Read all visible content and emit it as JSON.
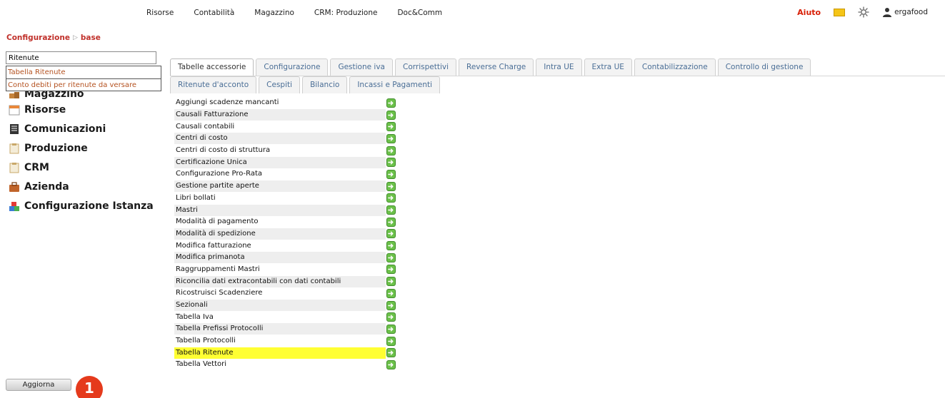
{
  "topnav": {
    "menu": [
      "Risorse",
      "Contabilità",
      "Magazzino",
      "CRM: Produzione",
      "Doc&Comm"
    ],
    "help": "Aiuto",
    "user": "ergafood"
  },
  "breadcrumb": {
    "first": "Configurazione",
    "sep": "▷",
    "second": "base"
  },
  "search": {
    "value": "Ritenute",
    "suggestions": [
      "Tabella Ritenute",
      "Conto debiti per ritenute da versare"
    ]
  },
  "sidebar": {
    "items": [
      {
        "label": "Magazzino",
        "icon": "boxes-icon",
        "color": "#c6833b"
      },
      {
        "label": "Risorse",
        "icon": "calendar-icon",
        "color": "#e8873a"
      },
      {
        "label": "Comunicazioni",
        "icon": "document-icon",
        "color": "#333333"
      },
      {
        "label": "Produzione",
        "icon": "clipboard-icon",
        "color": "#c9a86a"
      },
      {
        "label": "CRM",
        "icon": "clipboard-icon",
        "color": "#c9a86a"
      },
      {
        "label": "Azienda",
        "icon": "briefcase-icon",
        "color": "#c0642a"
      },
      {
        "label": "Configurazione Istanza",
        "icon": "blocks-icon",
        "color": "#3b7bd6"
      }
    ]
  },
  "tabs": {
    "row1": [
      "Tabelle accessorie",
      "Configurazione",
      "Gestione iva",
      "Corrispettivi",
      "Reverse Charge",
      "Intra UE",
      "Extra UE",
      "Contabilizzazione",
      "Controllo di gestione"
    ],
    "row2": [
      "Ritenute d'acconto",
      "Cespiti",
      "Bilancio",
      "Incassi e Pagamenti"
    ],
    "active": "Tabelle accessorie"
  },
  "list": {
    "items": [
      "Aggiungi scadenze mancanti",
      "Causali Fatturazione",
      "Causali contabili",
      "Centri di costo",
      "Centri di costo di struttura",
      "Certificazione Unica",
      "Configurazione Pro-Rata",
      "Gestione partite aperte",
      "Libri bollati",
      "Mastri",
      "Modalità di pagamento",
      "Modalità di spedizione",
      "Modifica fatturazione",
      "Modifica primanota",
      "Raggruppamenti Mastri",
      "Riconcilia dati extracontabili con dati contabili",
      "Ricostruisci Scadenziere",
      "Sezionali",
      "Tabella Iva",
      "Tabella Prefissi Protocolli",
      "Tabella Protocolli",
      "Tabella Ritenute",
      "Tabella Vettori"
    ],
    "highlighted": "Tabella Ritenute",
    "highlight_color": "#ffff33"
  },
  "footer": {
    "refresh_label": "Aggiorna",
    "badge": "1"
  },
  "colors": {
    "accent_red": "#d81e05",
    "tab_text": "#4a6e96",
    "suggestion_text": "#b4511f"
  }
}
